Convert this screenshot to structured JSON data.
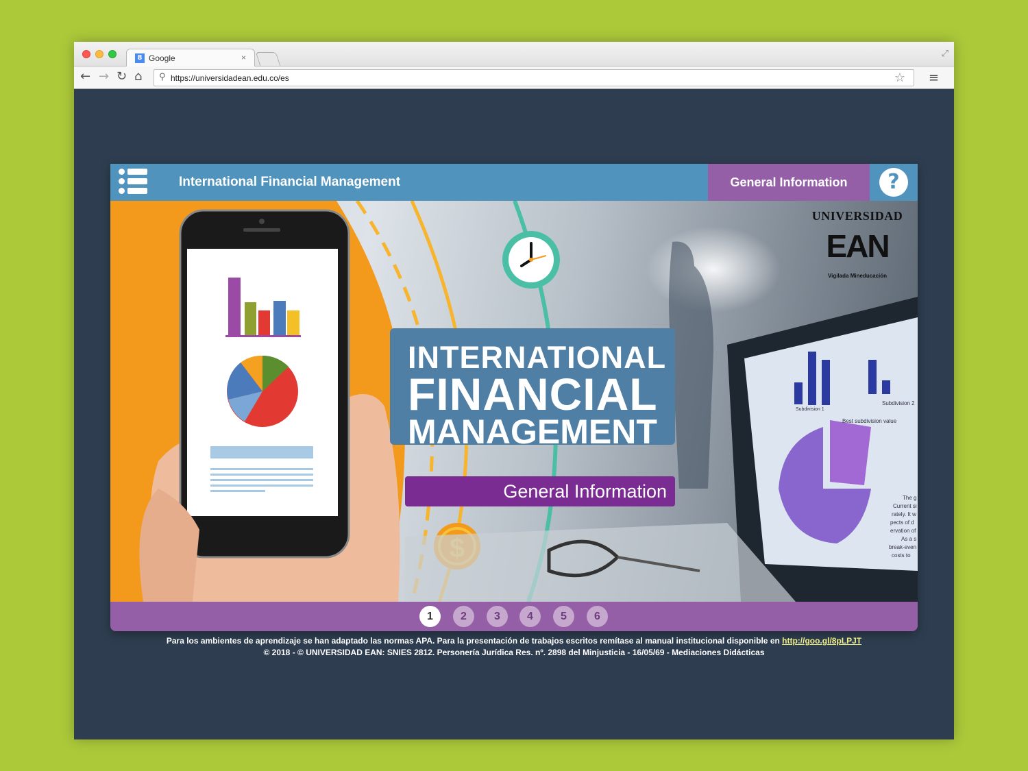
{
  "browser": {
    "tab_title": "Google",
    "tab_favicon": "8",
    "tab_close": "×",
    "url": "https://universidadean.edu.co/es",
    "icons": [
      "back-arrow-icon",
      "forward-arrow-icon",
      "reload-icon",
      "home-icon",
      "search-icon",
      "star-icon",
      "menu-icon",
      "fullscreen-icon"
    ]
  },
  "header": {
    "title": "International Financial Management",
    "tab_label": "General Information",
    "help_label": "?"
  },
  "hero": {
    "title_line1": "INTERNATIONAL",
    "title_line2": "FINANCIAL",
    "title_line3": "MANAGEMENT",
    "subtitle": "General Information",
    "logo": {
      "word": "UNIVERSIDAD",
      "acronym": "EAN",
      "tagline": "Vigilada Mineducación"
    },
    "monitor_labels": [
      "Subdivision 1",
      "Subdivision 2",
      "Best subdivision value"
    ],
    "monitor_text": [
      "The g",
      "Current si",
      "rately. It w",
      "pects of d",
      "ervation of",
      "As a s",
      "break-even",
      "costs to"
    ],
    "currency_symbol": "$"
  },
  "pager": {
    "pages": [
      "1",
      "2",
      "3",
      "4",
      "5",
      "6"
    ],
    "active": "1"
  },
  "footer": {
    "line1_text": "Para los ambientes de aprendizaje se han adaptado las normas APA. Para la presentación de trabajos escritos remítase al manual institucional disponible en ",
    "line1_link": "http://goo.gl/8pLPJT",
    "line2": "© 2018 - © UNIVERSIDAD EAN: SNIES 2812. Personería Jurídica Res. nº. 2898 del Minjusticia - 16/05/69 - Mediaciones Didácticas"
  },
  "colors": {
    "background": "#acc93a",
    "page_bg": "#2e3e50",
    "header_blue": "#5093bd",
    "purple": "#955fa7",
    "dark_purple": "#7a2c93",
    "orange": "#f39a1c",
    "teal": "#4bbfa6"
  }
}
